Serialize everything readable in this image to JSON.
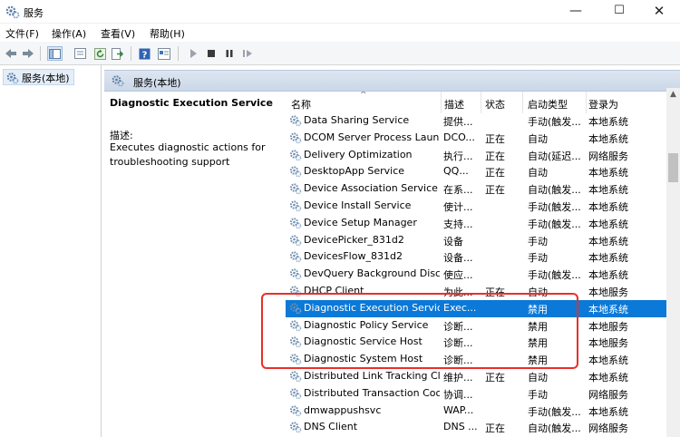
{
  "window": {
    "title": "服务"
  },
  "menu": {
    "items": [
      "文件(F)",
      "操作(A)",
      "查看(V)",
      "帮助(H)"
    ]
  },
  "tree": {
    "item_label": "服务(本地)"
  },
  "right_header": {
    "label": "服务(本地)"
  },
  "description": {
    "service_title": "Diagnostic Execution Service",
    "label": "描述:",
    "text": "Executes diagnostic actions for troubleshooting support"
  },
  "columns": {
    "name": "名称",
    "desc": "描述",
    "status": "状态",
    "startup": "启动类型",
    "logon": "登录为"
  },
  "rows": [
    {
      "name": "Data Sharing Service",
      "desc": "提供...",
      "status": "",
      "startup": "手动(触发...",
      "logon": "本地系统"
    },
    {
      "name": "DCOM Server Process Laun...",
      "desc": "DCO...",
      "status": "正在",
      "startup": "自动",
      "logon": "本地系统"
    },
    {
      "name": "Delivery Optimization",
      "desc": "执行...",
      "status": "正在",
      "startup": "自动(延迟...",
      "logon": "网络服务"
    },
    {
      "name": "DesktopApp Service",
      "desc": "QQ...",
      "status": "正在",
      "startup": "自动",
      "logon": "本地系统"
    },
    {
      "name": "Device Association Service",
      "desc": "在系...",
      "status": "正在",
      "startup": "自动(触发...",
      "logon": "本地系统"
    },
    {
      "name": "Device Install Service",
      "desc": "使计...",
      "status": "",
      "startup": "手动(触发...",
      "logon": "本地系统"
    },
    {
      "name": "Device Setup Manager",
      "desc": "支持...",
      "status": "",
      "startup": "手动(触发...",
      "logon": "本地系统"
    },
    {
      "name": "DevicePicker_831d2",
      "desc": "设备",
      "status": "",
      "startup": "手动",
      "logon": "本地系统"
    },
    {
      "name": "DevicesFlow_831d2",
      "desc": "设备...",
      "status": "",
      "startup": "手动",
      "logon": "本地系统"
    },
    {
      "name": "DevQuery Background Disc...",
      "desc": "使应...",
      "status": "",
      "startup": "手动(触发...",
      "logon": "本地系统"
    },
    {
      "name": "DHCP Client",
      "desc": "为此...",
      "status": "正在",
      "startup": "自动",
      "logon": "本地服务"
    },
    {
      "name": "Diagnostic Execution Service",
      "desc": "Exec...",
      "status": "",
      "startup": "禁用",
      "logon": "本地系统",
      "selected": true
    },
    {
      "name": "Diagnostic Policy Service",
      "desc": "诊断...",
      "status": "",
      "startup": "禁用",
      "logon": "本地服务"
    },
    {
      "name": "Diagnostic Service Host",
      "desc": "诊断...",
      "status": "",
      "startup": "禁用",
      "logon": "本地服务"
    },
    {
      "name": "Diagnostic System Host",
      "desc": "诊断...",
      "status": "",
      "startup": "禁用",
      "logon": "本地系统"
    },
    {
      "name": "Distributed Link Tracking Cl...",
      "desc": "维护...",
      "status": "正在",
      "startup": "自动",
      "logon": "本地系统"
    },
    {
      "name": "Distributed Transaction Coo...",
      "desc": "协调...",
      "status": "",
      "startup": "手动",
      "logon": "网络服务"
    },
    {
      "name": "dmwappushsvc",
      "desc": "WAP...",
      "status": "",
      "startup": "手动(触发...",
      "logon": "本地系统"
    },
    {
      "name": "DNS Client",
      "desc": "DNS ...",
      "status": "正在",
      "startup": "自动(触发...",
      "logon": "网络服务"
    }
  ],
  "colors": {
    "selection": "#0a79d7",
    "highlight_border": "#e8302a",
    "panel_header": "#d3deec"
  },
  "icons": {
    "service_row": "gear-icon",
    "toolbar": [
      "back-arrow-icon",
      "forward-arrow-icon",
      "console-tree-icon",
      "properties-icon",
      "refresh-icon",
      "export-icon",
      "help-icon",
      "mmc-icon",
      "play-icon",
      "stop-icon",
      "pause-icon",
      "resume-icon"
    ]
  }
}
